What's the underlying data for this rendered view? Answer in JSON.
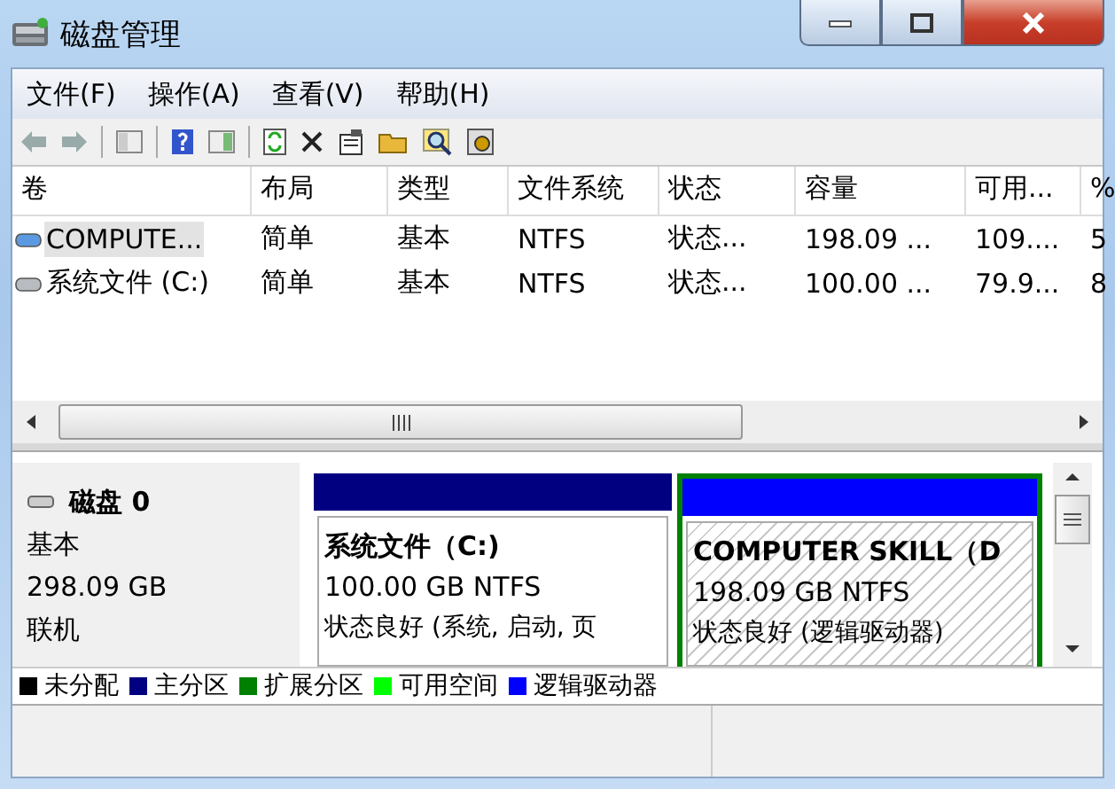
{
  "window": {
    "title": "磁盘管理"
  },
  "menu": [
    "文件(F)",
    "操作(A)",
    "查看(V)",
    "帮助(H)"
  ],
  "table": {
    "columns": [
      "卷",
      "布局",
      "类型",
      "文件系统",
      "状态",
      "容量",
      "可用...",
      "%"
    ],
    "rows": [
      {
        "kind": "logical",
        "selected": true,
        "cells": [
          "COMPUTE...",
          "简单",
          "基本",
          "NTFS",
          "状态...",
          "198.09 ...",
          "109....",
          "5"
        ]
      },
      {
        "kind": "system",
        "selected": false,
        "cells": [
          "系统文件 (C:)",
          "简单",
          "基本",
          "NTFS",
          "状态...",
          "100.00 ...",
          "79.9...",
          "8"
        ]
      }
    ]
  },
  "disk": {
    "name": "磁盘 0",
    "type": "基本",
    "size": "298.09 GB",
    "status": "联机",
    "partitions": [
      {
        "color": "#000080",
        "extended": false,
        "selected": false,
        "title": "系统文件（C:)",
        "size": "100.00 GB NTFS",
        "status": "状态良好 (系统, 启动, 页"
      },
      {
        "color": "#0000ff",
        "extended": true,
        "selected": true,
        "title": "COMPUTER SKILL（D",
        "size": "198.09 GB NTFS",
        "status": "状态良好 (逻辑驱动器)"
      }
    ]
  },
  "legend": [
    {
      "label": "未分配",
      "color": "#000000"
    },
    {
      "label": "主分区",
      "color": "#000080"
    },
    {
      "label": "扩展分区",
      "color": "#008000"
    },
    {
      "label": "可用空间",
      "color": "#00ff00"
    },
    {
      "label": "逻辑驱动器",
      "color": "#0000ff"
    }
  ]
}
